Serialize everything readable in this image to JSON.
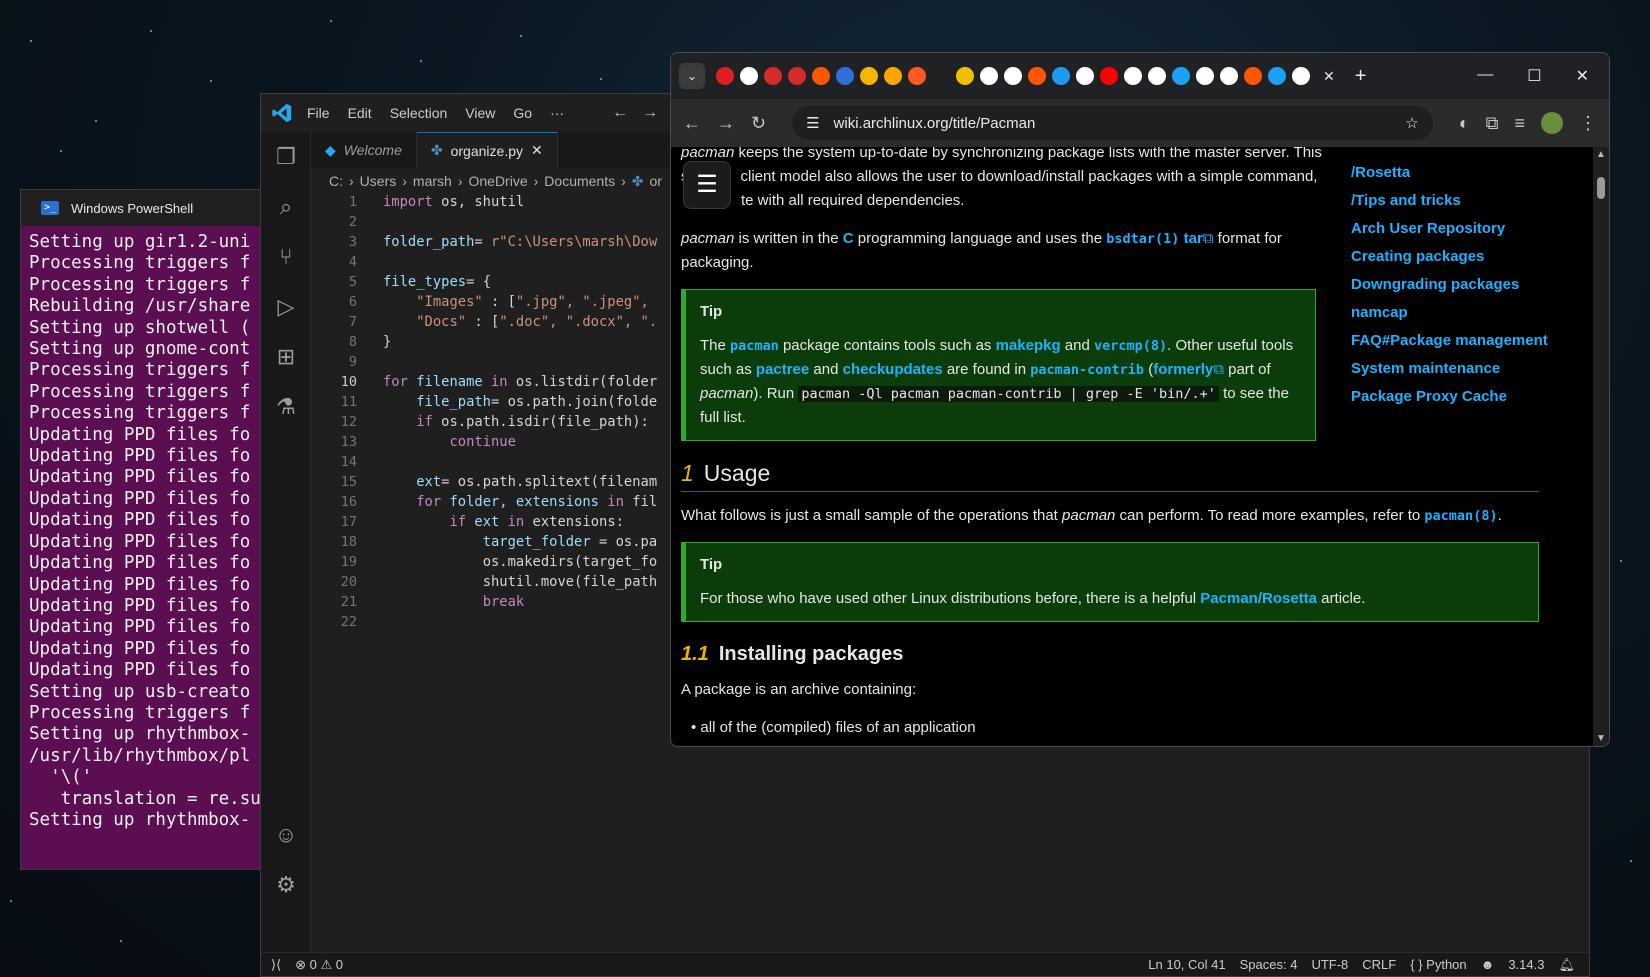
{
  "powershell": {
    "title": "Windows PowerShell",
    "lines": [
      "Setting up gir1.2-uni",
      "Processing triggers f",
      "Processing triggers f",
      "Rebuilding /usr/share",
      "Setting up shotwell (",
      "Setting up gnome-cont",
      "Processing triggers f",
      "Processing triggers f",
      "Processing triggers f",
      "Updating PPD files fo",
      "Updating PPD files fo",
      "Updating PPD files fo",
      "Updating PPD files fo",
      "Updating PPD files fo",
      "Updating PPD files fo",
      "Updating PPD files fo",
      "Updating PPD files fo",
      "Updating PPD files fo",
      "Updating PPD files fo",
      "Updating PPD files fo",
      "Updating PPD files fo",
      "Setting up usb-creato",
      "Processing triggers f",
      "Setting up rhythmbox-",
      "/usr/lib/rhythmbox/pl",
      "  '\\('",
      "   translation = re.su",
      "Setting up rhythmbox-"
    ]
  },
  "vscode": {
    "menu": [
      "File",
      "Edit",
      "Selection",
      "View",
      "Go",
      "···"
    ],
    "tabs": [
      {
        "label": "Welcome"
      },
      {
        "label": "organize.py",
        "close": "✕"
      }
    ],
    "breadcrumb": [
      "C:",
      "Users",
      "marsh",
      "OneDrive",
      "Documents",
      "or"
    ],
    "line_numbers": [
      "1",
      "2",
      "3",
      "4",
      "5",
      "6",
      "7",
      "8",
      "9",
      "10",
      "11",
      "12",
      "13",
      "14",
      "15",
      "16",
      "17",
      "18",
      "19",
      "20",
      "21",
      "22"
    ],
    "code": {
      "l1_kw": "import",
      "l1_rest": " os, shutil",
      "l3_var": "folder_path",
      "l3_eq": "= ",
      "l3_str": "r\"C:\\Users\\marsh\\Dow",
      "l5_var": "file_types",
      "l5_rest": "= {",
      "l6_key": "\"Images\"",
      "l6_rest": " : [",
      "l6_vals": "\".jpg\", \".jpeg\",",
      "l7_key": "\"Docs\"",
      "l7_rest": " : [",
      "l7_vals": "\".doc\", \".docx\", \".",
      "l8": "}",
      "l10_kw1": "for",
      "l10_var": " filename ",
      "l10_kw2": "in",
      "l10_rest": " os.listdir(folder",
      "l11_var": "file_path",
      "l11_rest": "= os.path.join(folde",
      "l12_kw": "if",
      "l12_rest": " os.path.isdir(file_path):",
      "l13_kw": "continue",
      "l15_var": "ext",
      "l15_rest": "= os.path.splitext(filenam",
      "l16_kw1": "for",
      "l16_var": " folder, extensions ",
      "l16_kw2": "in",
      "l16_rest": " fil",
      "l17_kw1": "if",
      "l17_var": " ext ",
      "l17_kw2": "in",
      "l17_rest": " extensions:",
      "l18_var": "target_folder",
      "l18_rest": " = os.pa",
      "l19_rest": "os.makedirs(target_fo",
      "l20_rest": "shutil.move(file_path",
      "l21_kw": "break"
    },
    "status": {
      "errors": "0",
      "warnings": "0",
      "position": "Ln 10, Col 41",
      "spaces": "Spaces: 4",
      "encoding": "UTF-8",
      "eol": "CRLF",
      "language": "Python",
      "version": "3.14.3"
    }
  },
  "chrome": {
    "url": "wiki.archlinux.org/title/Pacman",
    "tab_close": "✕",
    "new_tab": "+",
    "article": {
      "p1_em": "pacman",
      "p1_a": " keeps the system up-to-date by synchronizing package lists with the master server. This",
      "p1_b": "s",
      "p1_c": "client model also allows the user to download/install packages with a simple command,",
      "p1_d": "te with all required dependencies.",
      "p2_em": "pacman",
      "p2_a": " is written in the ",
      "p2_c": "C",
      "p2_b": " programming language and uses the ",
      "p2_bsdtar": "bsdtar(1)",
      "p2_tar": "tar",
      "p2_c2": " format for packaging.",
      "tip1_title": "Tip",
      "tip1_a": "The ",
      "tip1_pacman": "pacman",
      "tip1_b": " package contains tools such as ",
      "tip1_makepkg": "makepkg",
      "tip1_c": " and ",
      "tip1_vercmp": "vercmp(8)",
      "tip1_d": ". Other useful tools such as ",
      "tip1_pactree": "pactree",
      "tip1_e": " and ",
      "tip1_checkupdates": "checkupdates",
      "tip1_f": " are found in ",
      "tip1_contrib": "pacman-contrib",
      "tip1_g": " (",
      "tip1_formerly": "formerly",
      "tip1_h": " part of ",
      "tip1_em": "pacman",
      "tip1_i": "). Run ",
      "tip1_cmd": "pacman -Ql pacman pacman-contrib | grep -E 'bin/.+'",
      "tip1_j": " to see the full list.",
      "h_usage_num": "1",
      "h_usage": "Usage",
      "usage_a": "What follows is just a small sample of the operations that ",
      "usage_em": "pacman",
      "usage_b": " can perform. To read more examples, refer to ",
      "usage_link": "pacman(8)",
      "usage_c": ".",
      "tip2_title": "Tip",
      "tip2_a": "For those who have used other Linux distributions before, there is a helpful ",
      "tip2_link": "Pacman/Rosetta",
      "tip2_b": " article.",
      "h_install_num": "1.1",
      "h_install": "Installing packages",
      "install_p": "A package is an archive containing:",
      "install_li": "all of the (compiled) files of an application"
    },
    "toc": [
      "/Rosetta",
      "/Tips and tricks",
      "Arch User Repository",
      "Creating packages",
      "Downgrading packages",
      "namcap",
      "FAQ#Package management",
      "System maintenance",
      "Package Proxy Cache"
    ],
    "favicon_colors": [
      "#e02020",
      "#ffffff",
      "#d42b2b",
      "#d42b2b",
      "#ff5700",
      "#2f6fd8",
      "#f5b400",
      "#f6a800",
      "#ff5a1f",
      "#202020",
      "#f0c000",
      "#ffffff",
      "#ffffff",
      "#ff5700",
      "#1d9bf0",
      "#ffffff",
      "#ff0000",
      "#ffffff",
      "#ffffff",
      "#1ca0f2",
      "#ffffff",
      "#ffffff",
      "#ff5700",
      "#1ca0f2",
      "#ffffff"
    ]
  }
}
